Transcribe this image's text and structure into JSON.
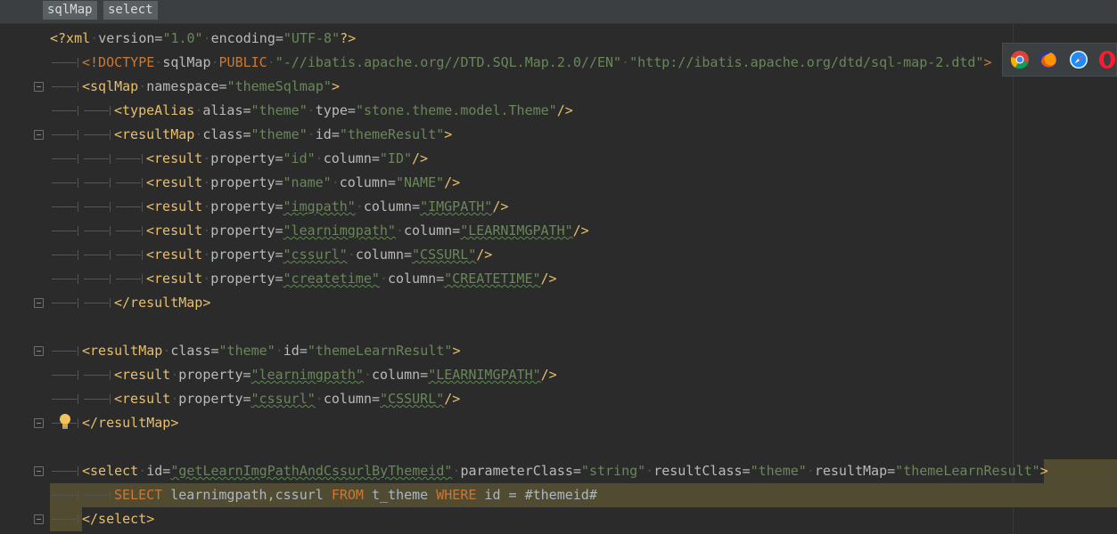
{
  "breadcrumbs": [
    "sqlMap",
    "select"
  ],
  "lines": [
    {
      "indent": 0,
      "fold": false,
      "hl": false,
      "segments": [
        {
          "t": "<?xml",
          "c": "tag"
        },
        {
          "t": "·",
          "c": "dot"
        },
        {
          "t": "version=",
          "c": "attr"
        },
        {
          "t": "\"1.0\"",
          "c": "val"
        },
        {
          "t": "·",
          "c": "dot"
        },
        {
          "t": "encoding=",
          "c": "attr"
        },
        {
          "t": "\"UTF-8\"",
          "c": "val"
        },
        {
          "t": "?>",
          "c": "tag"
        }
      ]
    },
    {
      "indent": 1,
      "fold": false,
      "hl": false,
      "segments": [
        {
          "t": "<!DOCTYPE",
          "c": "doct"
        },
        {
          "t": "·",
          "c": "dot"
        },
        {
          "t": "sqlMap",
          "c": "attr"
        },
        {
          "t": "·",
          "c": "dot"
        },
        {
          "t": "PUBLIC",
          "c": "doct"
        },
        {
          "t": "·",
          "c": "dot"
        },
        {
          "t": "\"-//ibatis.apache.org//DTD.SQL.Map.2.0//EN\"",
          "c": "val"
        },
        {
          "t": "·",
          "c": "dot"
        },
        {
          "t": "\"http://ibatis.apache.org/dtd/sql-map-2.dtd\"",
          "c": "val"
        },
        {
          "t": ">",
          "c": "doct"
        }
      ]
    },
    {
      "indent": 1,
      "fold": true,
      "hl": false,
      "segments": [
        {
          "t": "<sqlMap",
          "c": "tag"
        },
        {
          "t": "·",
          "c": "dot"
        },
        {
          "t": "namespace=",
          "c": "attr"
        },
        {
          "t": "\"themeSqlmap\"",
          "c": "val"
        },
        {
          "t": ">",
          "c": "tag"
        }
      ]
    },
    {
      "indent": 2,
      "fold": false,
      "hl": false,
      "segments": [
        {
          "t": "<typeAlias",
          "c": "tag"
        },
        {
          "t": "·",
          "c": "dot"
        },
        {
          "t": "alias=",
          "c": "attr"
        },
        {
          "t": "\"theme\"",
          "c": "val"
        },
        {
          "t": "·",
          "c": "dot"
        },
        {
          "t": "type=",
          "c": "attr"
        },
        {
          "t": "\"stone.theme.model.Theme\"",
          "c": "val"
        },
        {
          "t": "/>",
          "c": "tag"
        }
      ]
    },
    {
      "indent": 2,
      "fold": true,
      "hl": false,
      "segments": [
        {
          "t": "<resultMap",
          "c": "tag"
        },
        {
          "t": "·",
          "c": "dot"
        },
        {
          "t": "class=",
          "c": "attr"
        },
        {
          "t": "\"theme\"",
          "c": "val"
        },
        {
          "t": "·",
          "c": "dot"
        },
        {
          "t": "id=",
          "c": "attr"
        },
        {
          "t": "\"themeResult\"",
          "c": "val"
        },
        {
          "t": ">",
          "c": "tag"
        }
      ]
    },
    {
      "indent": 3,
      "fold": false,
      "hl": false,
      "segments": [
        {
          "t": "<result",
          "c": "tag"
        },
        {
          "t": "·",
          "c": "dot"
        },
        {
          "t": "property=",
          "c": "attr"
        },
        {
          "t": "\"id\"",
          "c": "val"
        },
        {
          "t": "·",
          "c": "dot"
        },
        {
          "t": "column=",
          "c": "attr"
        },
        {
          "t": "\"ID\"",
          "c": "val"
        },
        {
          "t": "/>",
          "c": "tag"
        }
      ]
    },
    {
      "indent": 3,
      "fold": false,
      "hl": false,
      "segments": [
        {
          "t": "<result",
          "c": "tag"
        },
        {
          "t": "·",
          "c": "dot"
        },
        {
          "t": "property=",
          "c": "attr"
        },
        {
          "t": "\"name\"",
          "c": "val"
        },
        {
          "t": "·",
          "c": "dot"
        },
        {
          "t": "column=",
          "c": "attr"
        },
        {
          "t": "\"NAME\"",
          "c": "val"
        },
        {
          "t": "/>",
          "c": "tag"
        }
      ]
    },
    {
      "indent": 3,
      "fold": false,
      "hl": false,
      "segments": [
        {
          "t": "<result",
          "c": "tag"
        },
        {
          "t": "·",
          "c": "dot"
        },
        {
          "t": "property=",
          "c": "attr"
        },
        {
          "t": "\"imgpath\"",
          "c": "val",
          "w": true
        },
        {
          "t": "·",
          "c": "dot"
        },
        {
          "t": "column=",
          "c": "attr"
        },
        {
          "t": "\"IMGPATH\"",
          "c": "val",
          "w": true
        },
        {
          "t": "/>",
          "c": "tag"
        }
      ]
    },
    {
      "indent": 3,
      "fold": false,
      "hl": false,
      "segments": [
        {
          "t": "<result",
          "c": "tag"
        },
        {
          "t": "·",
          "c": "dot"
        },
        {
          "t": "property=",
          "c": "attr"
        },
        {
          "t": "\"learnimgpath\"",
          "c": "val",
          "w": true
        },
        {
          "t": "·",
          "c": "dot"
        },
        {
          "t": "column=",
          "c": "attr"
        },
        {
          "t": "\"LEARNIMGPATH\"",
          "c": "val",
          "w": true
        },
        {
          "t": "/>",
          "c": "tag"
        }
      ]
    },
    {
      "indent": 3,
      "fold": false,
      "hl": false,
      "segments": [
        {
          "t": "<result",
          "c": "tag"
        },
        {
          "t": "·",
          "c": "dot"
        },
        {
          "t": "property=",
          "c": "attr"
        },
        {
          "t": "\"cssurl\"",
          "c": "val",
          "w": true
        },
        {
          "t": "·",
          "c": "dot"
        },
        {
          "t": "column=",
          "c": "attr"
        },
        {
          "t": "\"CSSURL\"",
          "c": "val",
          "w": true
        },
        {
          "t": "/>",
          "c": "tag"
        }
      ]
    },
    {
      "indent": 3,
      "fold": false,
      "hl": false,
      "segments": [
        {
          "t": "<result",
          "c": "tag"
        },
        {
          "t": "·",
          "c": "dot"
        },
        {
          "t": "property=",
          "c": "attr"
        },
        {
          "t": "\"createtime\"",
          "c": "val",
          "w": true
        },
        {
          "t": "·",
          "c": "dot"
        },
        {
          "t": "column=",
          "c": "attr"
        },
        {
          "t": "\"CREATETIME\"",
          "c": "val",
          "w": true
        },
        {
          "t": "/>",
          "c": "tag"
        }
      ]
    },
    {
      "indent": 2,
      "fold": true,
      "hl": false,
      "segments": [
        {
          "t": "</resultMap>",
          "c": "tag"
        }
      ]
    },
    {
      "indent": 0,
      "fold": false,
      "hl": false,
      "segments": []
    },
    {
      "indent": 1,
      "fold": true,
      "hl": false,
      "segments": [
        {
          "t": "<resultMap",
          "c": "tag"
        },
        {
          "t": "·",
          "c": "dot"
        },
        {
          "t": "class=",
          "c": "attr"
        },
        {
          "t": "\"theme\"",
          "c": "val"
        },
        {
          "t": "·",
          "c": "dot"
        },
        {
          "t": "id=",
          "c": "attr"
        },
        {
          "t": "\"themeLearnResult\"",
          "c": "val"
        },
        {
          "t": ">",
          "c": "tag"
        }
      ]
    },
    {
      "indent": 2,
      "fold": false,
      "hl": false,
      "segments": [
        {
          "t": "<result",
          "c": "tag"
        },
        {
          "t": "·",
          "c": "dot"
        },
        {
          "t": "property=",
          "c": "attr"
        },
        {
          "t": "\"learnimgpath\"",
          "c": "val",
          "w": true
        },
        {
          "t": "·",
          "c": "dot"
        },
        {
          "t": "column=",
          "c": "attr"
        },
        {
          "t": "\"LEARNIMGPATH\"",
          "c": "val",
          "w": true
        },
        {
          "t": "/>",
          "c": "tag"
        }
      ]
    },
    {
      "indent": 2,
      "fold": false,
      "hl": false,
      "segments": [
        {
          "t": "<result",
          "c": "tag"
        },
        {
          "t": "·",
          "c": "dot"
        },
        {
          "t": "property=",
          "c": "attr"
        },
        {
          "t": "\"cssurl\"",
          "c": "val",
          "w": true
        },
        {
          "t": "·",
          "c": "dot"
        },
        {
          "t": "column=",
          "c": "attr"
        },
        {
          "t": "\"CSSURL\"",
          "c": "val",
          "w": true
        },
        {
          "t": "/>",
          "c": "tag"
        }
      ]
    },
    {
      "indent": 1,
      "fold": true,
      "hl": false,
      "segments": [
        {
          "t": "</resultMap>",
          "c": "tag"
        }
      ]
    },
    {
      "indent": 0,
      "fold": false,
      "hl": false,
      "segments": []
    },
    {
      "indent": 1,
      "fold": true,
      "hl": "row",
      "segments": [
        {
          "t": "<select",
          "c": "tag"
        },
        {
          "t": "·",
          "c": "dot"
        },
        {
          "t": "id=",
          "c": "attr"
        },
        {
          "t": "\"getLearnImgPathAndCssurlByThemeid\"",
          "c": "val",
          "w": true
        },
        {
          "t": "·",
          "c": "dot"
        },
        {
          "t": "parameterClass=",
          "c": "attr"
        },
        {
          "t": "\"string\"",
          "c": "val"
        },
        {
          "t": "·",
          "c": "dot"
        },
        {
          "t": "resultClass=",
          "c": "attr"
        },
        {
          "t": "\"theme\"",
          "c": "val"
        },
        {
          "t": "·",
          "c": "dot"
        },
        {
          "t": "resultMap=",
          "c": "attr"
        },
        {
          "t": "\"themeLearnResult\"",
          "c": "val"
        },
        {
          "t": ">",
          "c": "tag"
        }
      ]
    },
    {
      "indent": 2,
      "fold": false,
      "hl": "full",
      "segments": [
        {
          "t": "SELECT",
          "c": "kw"
        },
        {
          "t": " learnimgpath,cssurl ",
          "c": "plain"
        },
        {
          "t": "FROM",
          "c": "kw"
        },
        {
          "t": " t_theme ",
          "c": "plain"
        },
        {
          "t": "WHERE",
          "c": "kw"
        },
        {
          "t": " id = #themeid#",
          "c": "plain"
        }
      ]
    },
    {
      "indent": 1,
      "fold": true,
      "hl": "left",
      "segments": [
        {
          "t": "</select>",
          "c": "tag"
        }
      ]
    }
  ],
  "browsers": [
    {
      "name": "chrome-icon",
      "colors": [
        "#db4437",
        "#0f9d58",
        "#f4b400",
        "#4285f4"
      ]
    },
    {
      "name": "firefox-icon",
      "colors": [
        "#e66000",
        "#ff9500",
        "#2a3a8c"
      ]
    },
    {
      "name": "safari-icon",
      "colors": [
        "#1a8cff",
        "#e8f4ff"
      ]
    },
    {
      "name": "opera-icon",
      "colors": [
        "#ff1b2d"
      ]
    }
  ],
  "colors": {
    "background": "#2b2b2b",
    "tag": "#e8bf6a",
    "attribute": "#bababa",
    "value": "#6a8759",
    "keyword": "#cc7832",
    "highlight": "#514c31"
  }
}
